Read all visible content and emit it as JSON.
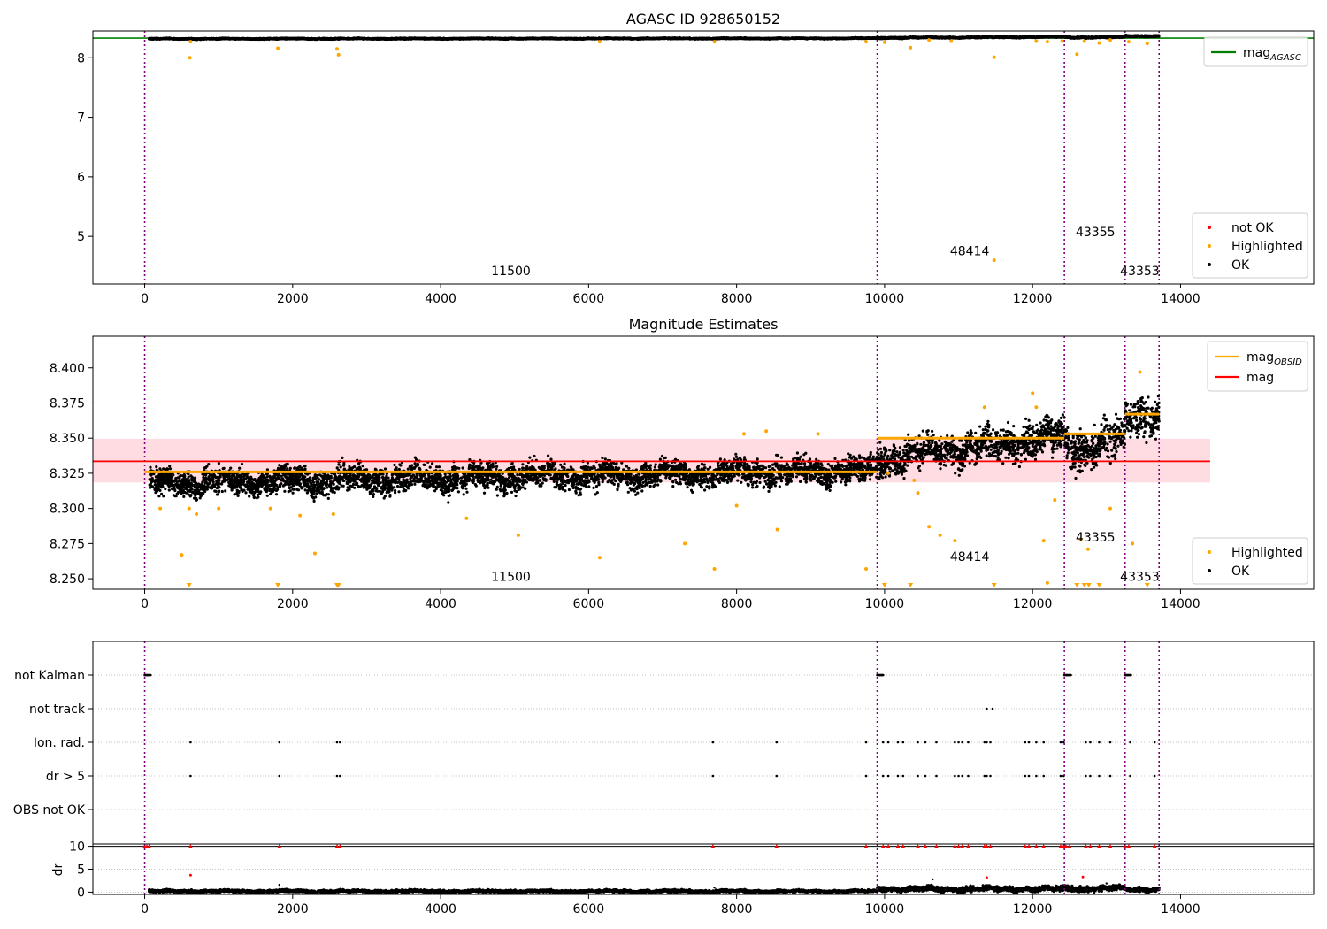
{
  "colors": {
    "ok": "#000000",
    "highlighted": "#ffa500",
    "not_ok": "#ff0000",
    "mag_agasc": "#008000",
    "mag": "#ff0000",
    "mag_obsid": "#ffa500",
    "obsid_divider": "#800080",
    "mag_band": "#ffc0cb",
    "grid": "#b0b0b0"
  },
  "chart_data": [
    {
      "type": "scatter",
      "title": "AGASC ID 928650152",
      "xlabel": "",
      "ylabel": "",
      "xlim": [
        -700,
        15800
      ],
      "ylim": [
        4.2,
        8.45
      ],
      "x_ticks": [
        0,
        2000,
        4000,
        6000,
        8000,
        10000,
        12000,
        14000
      ],
      "y_ticks": [
        5,
        6,
        7,
        8
      ],
      "x_tick_labels": [
        "0",
        "2000",
        "4000",
        "6000",
        "8000",
        "10000",
        "12000",
        "14000"
      ],
      "y_tick_labels": [
        "5",
        "6",
        "7",
        "8"
      ],
      "legend_lines": [
        {
          "name": "mag",
          "subscript": "AGASC",
          "color": "#008000"
        }
      ],
      "legend_lines_position": "top-right",
      "legend_points": [
        {
          "name": "not OK",
          "color": "#ff0000"
        },
        {
          "name": "Highlighted",
          "color": "#ffa500"
        },
        {
          "name": "OK",
          "color": "#000000"
        }
      ],
      "legend_points_position": "lower-right",
      "mag_agasc": 8.33,
      "obsid_boundaries": [
        0,
        9900,
        12430,
        13250,
        13710
      ],
      "obsid_labels": [
        {
          "text": "11500",
          "x": 4950,
          "y": 4.35
        },
        {
          "text": "48414",
          "x": 11150,
          "y": 4.68
        },
        {
          "text": "43355",
          "x": 12850,
          "y": 5.0
        },
        {
          "text": "43353",
          "x": 13450,
          "y": 4.35
        }
      ],
      "ok_segments": [
        {
          "x0": 60,
          "x1": 9900,
          "y0": 8.318,
          "y1": 8.327,
          "scatter": 0.008
        },
        {
          "x0": 9900,
          "x1": 12430,
          "y0": 8.335,
          "y1": 8.352,
          "scatter": 0.01
        },
        {
          "x0": 12430,
          "x1": 13250,
          "y0": 8.343,
          "y1": 8.348,
          "scatter": 0.012
        },
        {
          "x0": 13250,
          "x1": 13710,
          "y0": 8.365,
          "y1": 8.368,
          "scatter": 0.012
        }
      ],
      "highlighted_points": [
        [
          610,
          8.0
        ],
        [
          620,
          8.27
        ],
        [
          1800,
          8.16
        ],
        [
          2600,
          8.15
        ],
        [
          2620,
          8.05
        ],
        [
          6150,
          8.27
        ],
        [
          7700,
          8.27
        ],
        [
          9750,
          8.27
        ],
        [
          10000,
          8.26
        ],
        [
          10350,
          8.17
        ],
        [
          10600,
          8.3
        ],
        [
          10900,
          8.28
        ],
        [
          11480,
          8.01
        ],
        [
          11480,
          4.6
        ],
        [
          12050,
          8.28
        ],
        [
          12200,
          8.27
        ],
        [
          12400,
          8.28
        ],
        [
          12600,
          8.06
        ],
        [
          12700,
          8.28
        ],
        [
          12900,
          8.25
        ],
        [
          13050,
          8.3
        ],
        [
          13300,
          8.27
        ],
        [
          13550,
          8.24
        ]
      ]
    },
    {
      "type": "scatter",
      "title": "Magnitude Estimates",
      "xlabel": "",
      "ylabel": "",
      "xlim": [
        -700,
        15800
      ],
      "ylim": [
        8.2425,
        8.4225
      ],
      "x_ticks": [
        0,
        2000,
        4000,
        6000,
        8000,
        10000,
        12000,
        14000
      ],
      "y_ticks": [
        8.25,
        8.275,
        8.3,
        8.325,
        8.35,
        8.375,
        8.4
      ],
      "x_tick_labels": [
        "0",
        "2000",
        "4000",
        "6000",
        "8000",
        "10000",
        "12000",
        "14000"
      ],
      "y_tick_labels": [
        "8.250",
        "8.275",
        "8.300",
        "8.325",
        "8.350",
        "8.375",
        "8.400"
      ],
      "legend_lines": [
        {
          "name": "mag",
          "subscript": "OBSID",
          "color": "#ffa500"
        },
        {
          "name": "mag",
          "subscript": "",
          "color": "#ff0000"
        }
      ],
      "legend_lines_position": "top-right",
      "legend_points": [
        {
          "name": "Highlighted",
          "color": "#ffa500"
        },
        {
          "name": "OK",
          "color": "#000000"
        }
      ],
      "legend_points_position": "lower-right",
      "mag": 8.3335,
      "mag_band": [
        8.3185,
        8.3495
      ],
      "mag_line_xlim": [
        -700,
        14400
      ],
      "obsid_boundaries": [
        0,
        9900,
        12430,
        13250,
        13710
      ],
      "obsid_labels": [
        {
          "text": "11500",
          "x": 4950,
          "y": 8.2485
        },
        {
          "text": "48414",
          "x": 11150,
          "y": 8.2625
        },
        {
          "text": "43355",
          "x": 12850,
          "y": 8.2765
        },
        {
          "text": "43353",
          "x": 13450,
          "y": 8.2485
        }
      ],
      "mag_obsid": [
        {
          "x0": 0,
          "x1": 9900,
          "y": 8.326
        },
        {
          "x0": 9900,
          "x1": 12430,
          "y": 8.35
        },
        {
          "x0": 12430,
          "x1": 13250,
          "y": 8.353
        },
        {
          "x0": 13250,
          "x1": 13710,
          "y": 8.367
        }
      ],
      "ok_segments": [
        {
          "x0": 60,
          "x1": 9900,
          "y0": 8.318,
          "y1": 8.327,
          "scatter": 0.008
        },
        {
          "x0": 9900,
          "x1": 12430,
          "y0": 8.335,
          "y1": 8.352,
          "scatter": 0.01
        },
        {
          "x0": 12430,
          "x1": 13250,
          "y0": 8.343,
          "y1": 8.348,
          "scatter": 0.012
        },
        {
          "x0": 13250,
          "x1": 13710,
          "y0": 8.365,
          "y1": 8.368,
          "scatter": 0.012
        }
      ],
      "highlighted_points": [
        [
          210,
          8.3
        ],
        [
          500,
          8.267
        ],
        [
          600,
          8.3
        ],
        [
          700,
          8.296
        ],
        [
          1000,
          8.3
        ],
        [
          1700,
          8.3
        ],
        [
          2100,
          8.295
        ],
        [
          2300,
          8.268
        ],
        [
          2550,
          8.296
        ],
        [
          4350,
          8.293
        ],
        [
          5050,
          8.281
        ],
        [
          6150,
          8.265
        ],
        [
          7300,
          8.275
        ],
        [
          7700,
          8.257
        ],
        [
          8000,
          8.302
        ],
        [
          8100,
          8.353
        ],
        [
          8400,
          8.355
        ],
        [
          8550,
          8.285
        ],
        [
          9100,
          8.353
        ],
        [
          9750,
          8.257
        ],
        [
          10050,
          8.325
        ],
        [
          10400,
          8.32
        ],
        [
          10450,
          8.311
        ],
        [
          10600,
          8.287
        ],
        [
          10750,
          8.281
        ],
        [
          10950,
          8.277
        ],
        [
          11350,
          8.372
        ],
        [
          12000,
          8.382
        ],
        [
          12050,
          8.372
        ],
        [
          12150,
          8.277
        ],
        [
          12300,
          8.306
        ],
        [
          12650,
          8.278
        ],
        [
          12750,
          8.271
        ],
        [
          13050,
          8.3
        ],
        [
          13450,
          8.397
        ],
        [
          13350,
          8.275
        ],
        [
          12200,
          8.247
        ]
      ],
      "clipped_low_points": [
        600,
        1800,
        2600,
        2620,
        10000,
        10350,
        11480,
        12600,
        12700,
        12760,
        12900,
        13550
      ]
    },
    {
      "type": "scatter",
      "title": "",
      "xlabel": "",
      "ylabel": "",
      "xlim": [
        -700,
        15800
      ],
      "flag_rows": [
        "not Kalman",
        "not track",
        "Ion. rad.",
        "dr > 5",
        "OBS not OK"
      ],
      "obsid_boundaries": [
        0,
        9900,
        12430,
        13250,
        13710
      ],
      "flag_points": {
        "not Kalman": [
          [
            0,
            80
          ],
          [
            9900,
            9980
          ],
          [
            12430,
            12520
          ],
          [
            13250,
            13330
          ]
        ],
        "not track": [
          11380,
          11460
        ],
        "Ion. rad.": [
          620,
          1820,
          2600,
          2640,
          7680,
          8540,
          9750,
          9980,
          10050,
          10180,
          10250,
          10450,
          10550,
          10700,
          10950,
          11000,
          11050,
          11130,
          11350,
          11380,
          11430,
          11900,
          11950,
          12050,
          12150,
          12380,
          12420,
          12720,
          12780,
          12900,
          13050,
          13320,
          13650
        ],
        "dr > 5": [
          620,
          1820,
          2600,
          2640,
          7680,
          8540,
          9750,
          9980,
          10050,
          10180,
          10250,
          10450,
          10550,
          10700,
          10950,
          11000,
          11050,
          11130,
          11350,
          11380,
          11430,
          11900,
          11950,
          12050,
          12150,
          12380,
          12420,
          12720,
          12780,
          12900,
          13050,
          13320,
          13650
        ],
        "OBS not OK": []
      }
    },
    {
      "type": "scatter",
      "title": "",
      "xlabel": "",
      "ylabel": "dr",
      "xlim": [
        -700,
        15800
      ],
      "ylim": [
        -0.5,
        10.5
      ],
      "x_ticks": [
        0,
        2000,
        4000,
        6000,
        8000,
        10000,
        12000,
        14000
      ],
      "y_ticks": [
        0,
        5,
        10
      ],
      "x_tick_labels": [
        "0",
        "2000",
        "4000",
        "6000",
        "8000",
        "10000",
        "12000",
        "14000"
      ],
      "y_tick_labels": [
        "0",
        "5",
        "10"
      ],
      "obsid_boundaries": [
        0,
        9900,
        12430,
        13250,
        13710
      ],
      "clipped_high_points": [
        0,
        30,
        60,
        620,
        1820,
        2600,
        2640,
        7680,
        8540,
        9750,
        9980,
        10050,
        10180,
        10250,
        10450,
        10550,
        10700,
        10950,
        11000,
        11050,
        11130,
        11350,
        11380,
        11430,
        11900,
        11950,
        12050,
        12150,
        12380,
        12420,
        12450,
        12500,
        12720,
        12780,
        12900,
        13050,
        13250,
        13300,
        13650
      ],
      "not_ok_points": [
        [
          620,
          3.7
        ],
        [
          11380,
          3.2
        ],
        [
          12680,
          3.3
        ]
      ],
      "ok_segments": [
        {
          "x0": 60,
          "x1": 9900,
          "y": 0.2,
          "scatter": 0.25
        },
        {
          "x0": 9900,
          "x1": 12430,
          "y": 0.7,
          "scatter": 0.5
        },
        {
          "x0": 12430,
          "x1": 13250,
          "y": 0.8,
          "scatter": 0.5
        },
        {
          "x0": 13250,
          "x1": 13710,
          "y": 0.6,
          "scatter": 0.4
        }
      ],
      "ok_outliers": [
        [
          1820,
          1.6
        ],
        [
          7700,
          1.0
        ],
        [
          10650,
          2.8
        ],
        [
          13000,
          1.9
        ]
      ]
    }
  ]
}
